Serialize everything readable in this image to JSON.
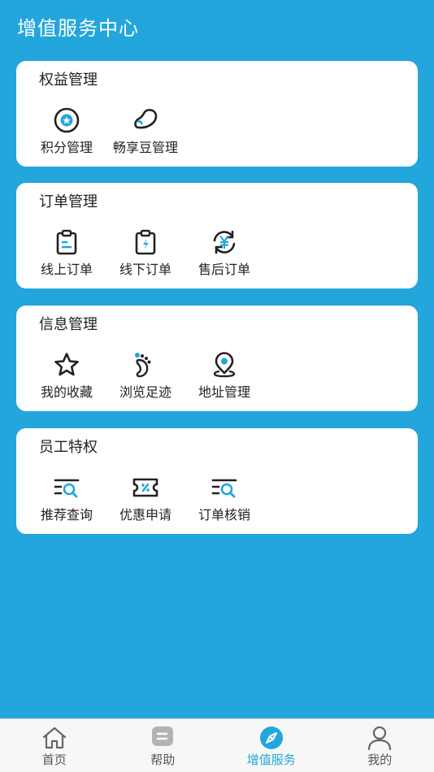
{
  "header": {
    "title": "增值服务中心"
  },
  "sections": [
    {
      "title": "权益管理",
      "items": [
        {
          "label": "积分管理",
          "icon": "points-icon"
        },
        {
          "label": "畅享豆管理",
          "icon": "bean-icon"
        }
      ]
    },
    {
      "title": "订单管理",
      "items": [
        {
          "label": "线上订单",
          "icon": "clipboard-list-icon"
        },
        {
          "label": "线下订单",
          "icon": "clipboard-bolt-icon"
        },
        {
          "label": "售后订单",
          "icon": "refund-cycle-icon"
        }
      ]
    },
    {
      "title": "信息管理",
      "items": [
        {
          "label": "我的收藏",
          "icon": "star-icon"
        },
        {
          "label": "浏览足迹",
          "icon": "footprint-icon"
        },
        {
          "label": "地址管理",
          "icon": "location-pin-icon"
        }
      ]
    },
    {
      "title": "员工特权",
      "items": [
        {
          "label": "推荐查询",
          "icon": "list-search-icon"
        },
        {
          "label": "优惠申请",
          "icon": "coupon-icon"
        },
        {
          "label": "订单核销",
          "icon": "list-search-icon"
        }
      ]
    }
  ],
  "tabbar": {
    "items": [
      {
        "label": "首页",
        "icon": "home-icon"
      },
      {
        "label": "帮助",
        "icon": "help-chat-icon"
      },
      {
        "label": "增值服务",
        "icon": "compass-icon",
        "active": true
      },
      {
        "label": "我的",
        "icon": "user-icon"
      }
    ]
  },
  "colors": {
    "accent": "#22a6dc",
    "text": "#222222",
    "card": "#ffffff",
    "tabbar": "#f7f7f7"
  }
}
